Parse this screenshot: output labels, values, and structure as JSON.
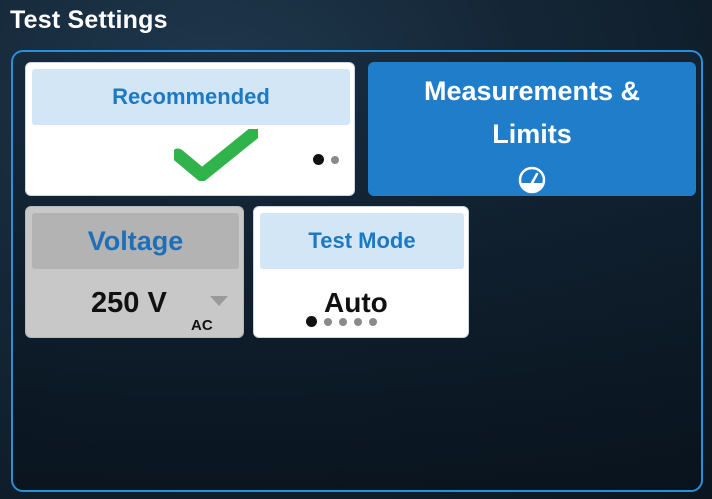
{
  "screen": {
    "title": "Test Settings"
  },
  "tiles": {
    "recommended": {
      "label": "Recommended",
      "icon": "checkmark-icon",
      "page_dots": {
        "count": 2,
        "active": 1
      }
    },
    "measurements": {
      "label_line1": "Measurements &",
      "label_line2": "Limits",
      "icon": "gauge-icon"
    },
    "voltage": {
      "label": "Voltage",
      "value": "250 V",
      "unit_suffix": "AC",
      "icon": "dropdown-caret-icon"
    },
    "test_mode": {
      "label": "Test Mode",
      "value": "Auto",
      "page_dots": {
        "count": 5,
        "active": 1
      }
    }
  },
  "colors": {
    "accent_blue": "#1f7dc9",
    "panel_border": "#2b8fd6",
    "check_green": "#2fb34a",
    "header_light": "#d3e6f5",
    "header_text": "#1c79c4"
  }
}
